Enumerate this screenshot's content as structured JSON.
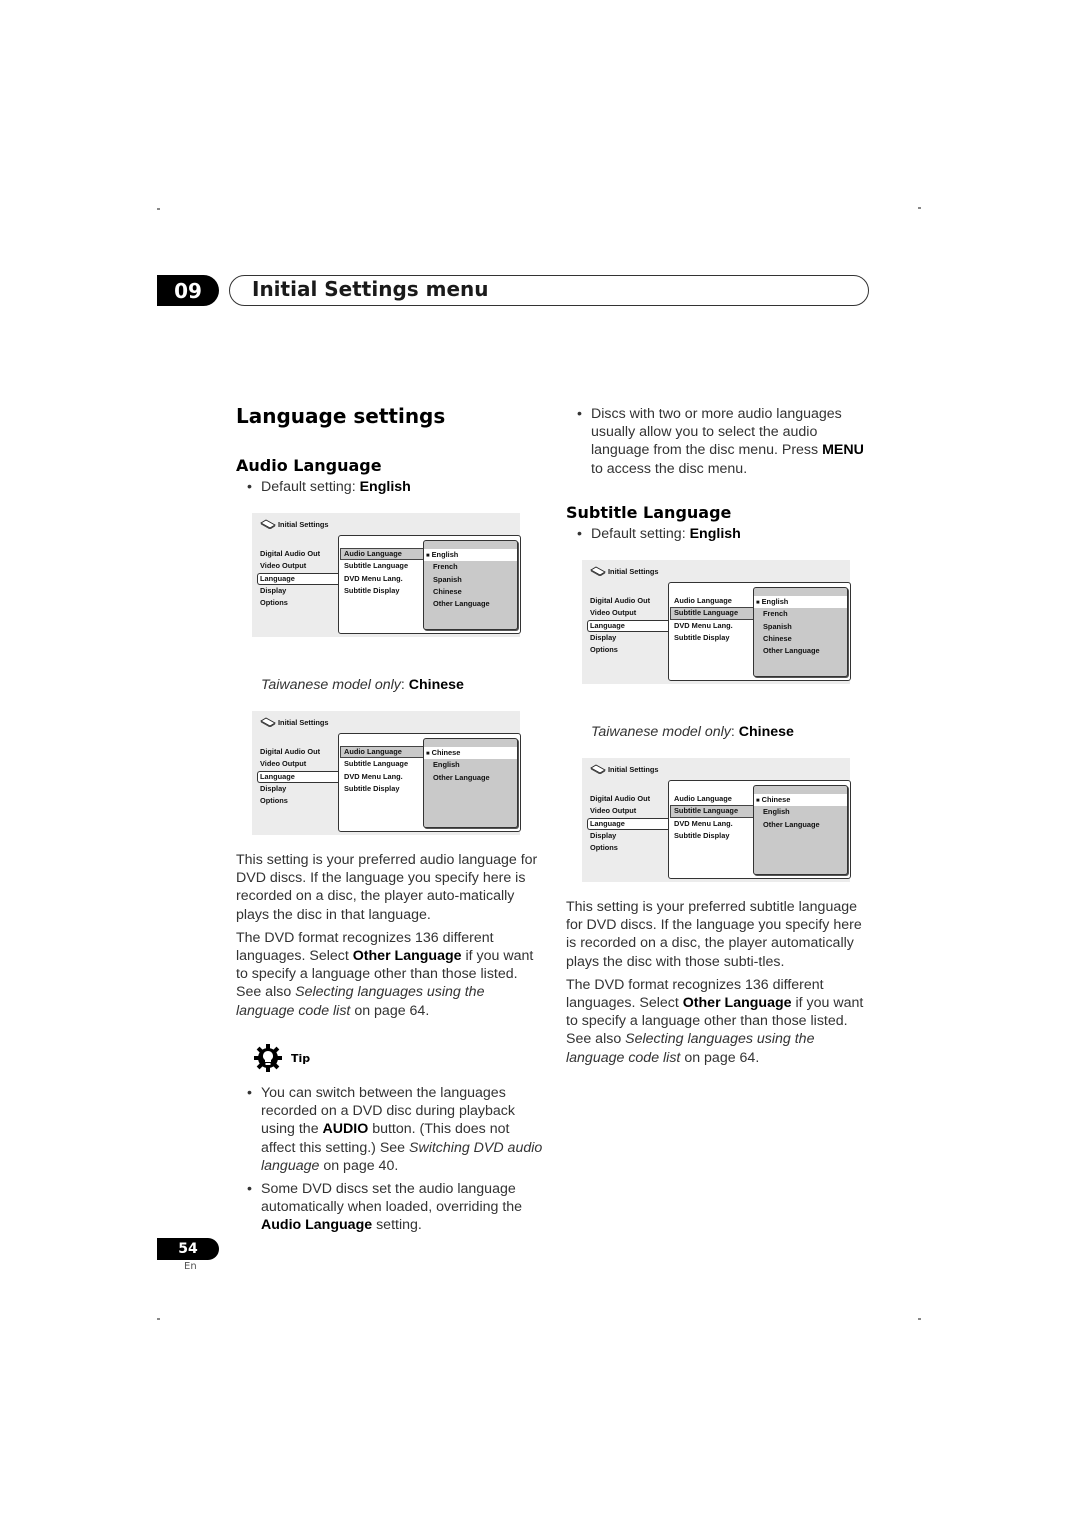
{
  "chapter": {
    "number": "09",
    "title": "Initial Settings menu"
  },
  "section": {
    "title": "Language settings"
  },
  "audio_language": {
    "heading": "Audio Language",
    "default_prefix": "Default setting: ",
    "default_value": "English",
    "taiwan_prefix": "Taiwanese model only",
    "taiwan_sep": ": ",
    "taiwan_value": "Chinese",
    "para1": "This setting is your preferred audio language for DVD discs. If the language you specify here is recorded on a disc, the player auto-matically plays the disc in that language.",
    "para2_a": "The DVD format recognizes 136 different languages. Select ",
    "para2_bold": "Other Language",
    "para2_b": " if you want to specify a language other than those listed. See also ",
    "para2_italic": "Selecting languages using the language code list",
    "para2_c": " on page 64.",
    "tip_label": "Tip",
    "tips": [
      {
        "a": "You can switch between the languages recorded on a DVD disc during playback using the ",
        "bold": "AUDIO",
        "b": " button. (This does not affect this setting.) See ",
        "italic": "Switching DVD audio language",
        "c": " on page 40."
      },
      {
        "a": "Some DVD discs set the audio language automatically when loaded, overriding the ",
        "bold": "Audio Language",
        "b": " setting."
      }
    ]
  },
  "right_bullet": {
    "a": "Discs with two or more audio languages usually allow you to select the audio language from the disc menu. Press ",
    "bold": "MENU",
    "b": " to access the disc menu."
  },
  "subtitle_language": {
    "heading": "Subtitle Language",
    "default_prefix": "Default setting: ",
    "default_value": "English",
    "taiwan_prefix": "Taiwanese model only",
    "taiwan_sep": ": ",
    "taiwan_value": "Chinese",
    "para1": "This setting is your preferred subtitle language for DVD discs. If the language you specify here is recorded on a disc, the player automatically plays the disc with those subti-tles.",
    "para2_a": "The DVD format recognizes 136 different languages. Select ",
    "para2_bold": "Other Language",
    "para2_b": " if you want to specify a language other than those listed. See also ",
    "para2_italic": "Selecting languages using the language code list",
    "para2_c": " on page 64."
  },
  "osd": {
    "title": "Initial Settings",
    "menu": [
      "Digital Audio Out",
      "Video Output",
      "Language",
      "Display",
      "Options"
    ],
    "submenu": [
      "Audio Language",
      "Subtitle Language",
      "DVD Menu Lang.",
      "Subtitle Display"
    ],
    "options_standard": [
      "English",
      "French",
      "Spanish",
      "Chinese",
      "Other Language"
    ],
    "options_taiwan": [
      "Chinese",
      "English",
      "Other Language"
    ]
  },
  "footer": {
    "page": "54",
    "lang": "En"
  }
}
